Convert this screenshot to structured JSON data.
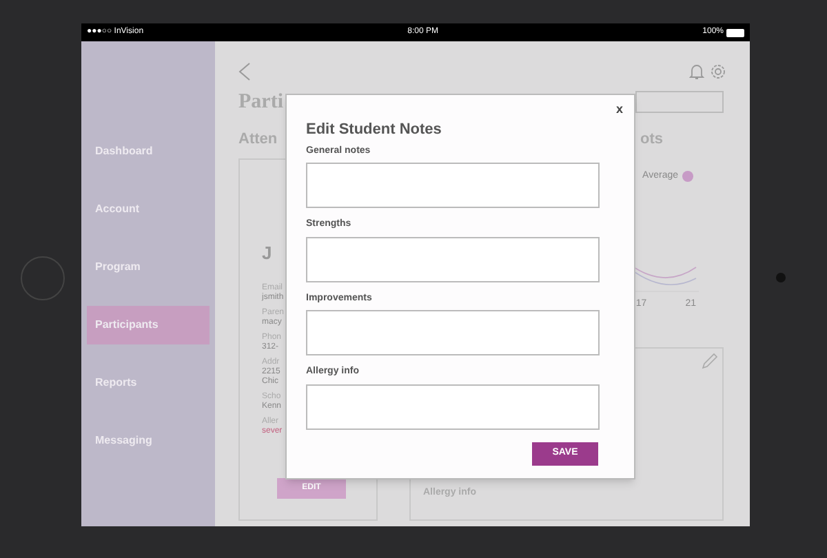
{
  "status_bar": {
    "carrier": "●●●○○ InVision",
    "time": "8:00 PM",
    "battery": "100%"
  },
  "sidebar": {
    "items": [
      {
        "label": "Dashboard",
        "selected": false
      },
      {
        "label": "Account",
        "selected": false
      },
      {
        "label": "Program",
        "selected": false
      },
      {
        "label": "Participants",
        "selected": true
      },
      {
        "label": "Reports",
        "selected": false
      },
      {
        "label": "Messaging",
        "selected": false
      }
    ]
  },
  "page": {
    "title": "Parti",
    "section_left": "Atten",
    "section_right": "ots",
    "profile": {
      "initial": "J",
      "fields": [
        {
          "label": "Email",
          "value": "jsmith",
          "alert": false
        },
        {
          "label": "Paren",
          "value": "macy",
          "alert": false
        },
        {
          "label": "Phon",
          "value": "312-",
          "alert": false
        },
        {
          "label": "Addr",
          "value": "2215\nChic",
          "alert": false
        },
        {
          "label": "Scho",
          "value": "Kenn",
          "alert": false
        },
        {
          "label": "Aller",
          "value": "sever",
          "alert": true
        }
      ],
      "edit_button": "EDIT"
    },
    "chart": {
      "legend": "Average",
      "x_labels": [
        "17",
        "21"
      ]
    },
    "notes_card": {
      "label": "Allergy info"
    }
  },
  "modal": {
    "title": "Edit Student Notes",
    "close": "x",
    "fields": [
      {
        "label": "General notes"
      },
      {
        "label": "Strengths"
      },
      {
        "label": "Improvements"
      },
      {
        "label": "Allergy info"
      }
    ],
    "save_button": "SAVE"
  }
}
